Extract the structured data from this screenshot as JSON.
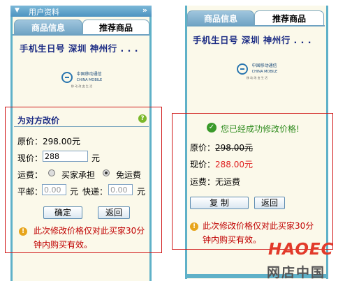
{
  "left": {
    "header_title": "用户资料",
    "tabs": [
      "商品信息",
      "推荐商品"
    ],
    "product_name": "手机生日号 深圳 神州行 . . .",
    "logo": {
      "line1": "中国移动通信",
      "line2": "CHINA MOBILE",
      "line3": "移 动 改 变 生 活"
    },
    "dialog": {
      "title": "为对方改价",
      "help_icon": "question-icon",
      "original_price_label": "原价：",
      "original_price_value": "298.00元",
      "current_price_label": "现价：",
      "current_price_input": "288",
      "currency_unit": "元",
      "shipping_label": "运费：",
      "shipping_options": [
        "买家承担",
        "免运费"
      ],
      "shipping_selected": "免运费",
      "ordinary_mail_label": "平邮：",
      "ordinary_mail_value": "0.00",
      "express_label": "快递：",
      "express_value": "0.00",
      "confirm_button": "确定",
      "back_button": "返回",
      "note_line1": "此次修改价格仅对此买家30分",
      "note_line2": "钟内购买有效。"
    }
  },
  "right": {
    "tabs": [
      "商品信息",
      "推荐商品"
    ],
    "product_name": "手机生日号 深圳 神州行 . . .",
    "logo": {
      "line1": "中国移动通信",
      "line2": "CHINA MOBILE",
      "line3": "移 动 改 变 生 活"
    },
    "dialog": {
      "success_text": "您已经成功修改价格!",
      "original_price_label": "原价：",
      "original_price_value": "298.00元",
      "current_price_label": "现价：",
      "current_price_value": "288.00元",
      "shipping_label": "运费：",
      "shipping_value": "无运费",
      "copy_button": "复 制",
      "back_button": "返回",
      "note_line1": "此次修改价格仅对此买家30分",
      "note_line2": "钟内购买有效。"
    }
  },
  "watermark": {
    "line1": "HAOEC",
    "line2": "网店中国"
  }
}
